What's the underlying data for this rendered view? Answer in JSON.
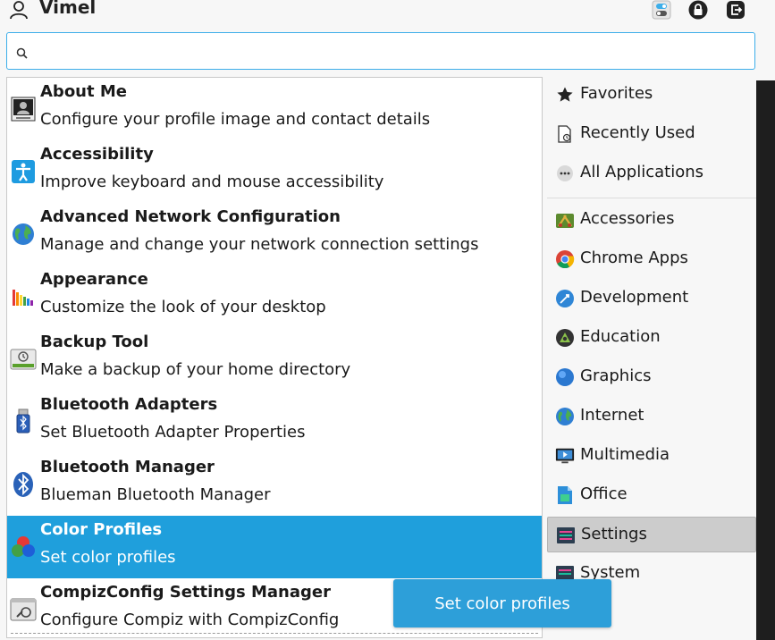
{
  "header": {
    "user_name": "Vimel",
    "icons": [
      "user-icon",
      "toggle-switch-icon",
      "lock-icon",
      "logout-icon"
    ]
  },
  "search": {
    "value": "",
    "placeholder": ""
  },
  "results": [
    {
      "title": "About Me",
      "desc": "Configure your profile image and contact details",
      "icon": "about-me-icon"
    },
    {
      "title": "Accessibility",
      "desc": "Improve keyboard and mouse accessibility",
      "icon": "accessibility-icon"
    },
    {
      "title": "Advanced Network Configuration",
      "desc": "Manage and change your network connection settings",
      "icon": "network-globe-icon"
    },
    {
      "title": "Appearance",
      "desc": "Customize the look of your desktop",
      "icon": "appearance-icon"
    },
    {
      "title": "Backup Tool",
      "desc": "Make a backup of your home directory",
      "icon": "backup-icon"
    },
    {
      "title": "Bluetooth Adapters",
      "desc": "Set Bluetooth Adapter Properties",
      "icon": "bluetooth-adapter-icon"
    },
    {
      "title": "Bluetooth Manager",
      "desc": "Blueman Bluetooth Manager",
      "icon": "bluetooth-icon"
    },
    {
      "title": "Color Profiles",
      "desc": "Set color profiles",
      "icon": "color-profiles-icon",
      "selected": true
    },
    {
      "title": "CompizConfig Settings Manager",
      "desc": "Configure Compiz with CompizConfig",
      "icon": "compiz-icon"
    }
  ],
  "categories": [
    {
      "label": "Favorites",
      "icon": "star-icon"
    },
    {
      "label": "Recently Used",
      "icon": "recent-document-icon"
    },
    {
      "label": "All Applications",
      "icon": "all-apps-icon"
    },
    {
      "label": "Accessories",
      "icon": "accessories-icon"
    },
    {
      "label": "Chrome Apps",
      "icon": "chrome-icon"
    },
    {
      "label": "Development",
      "icon": "development-icon"
    },
    {
      "label": "Education",
      "icon": "education-icon"
    },
    {
      "label": "Graphics",
      "icon": "graphics-icon"
    },
    {
      "label": "Internet",
      "icon": "internet-icon"
    },
    {
      "label": "Multimedia",
      "icon": "multimedia-icon"
    },
    {
      "label": "Office",
      "icon": "office-icon"
    },
    {
      "label": "Settings",
      "icon": "settings-icon",
      "selected": true
    },
    {
      "label": "System",
      "icon": "system-icon"
    }
  ],
  "tooltip": {
    "text": "Set color profiles"
  },
  "colors": {
    "accent": "#1f9fdc",
    "search_border": "#3daee9",
    "selected_category": "#cccccc"
  }
}
